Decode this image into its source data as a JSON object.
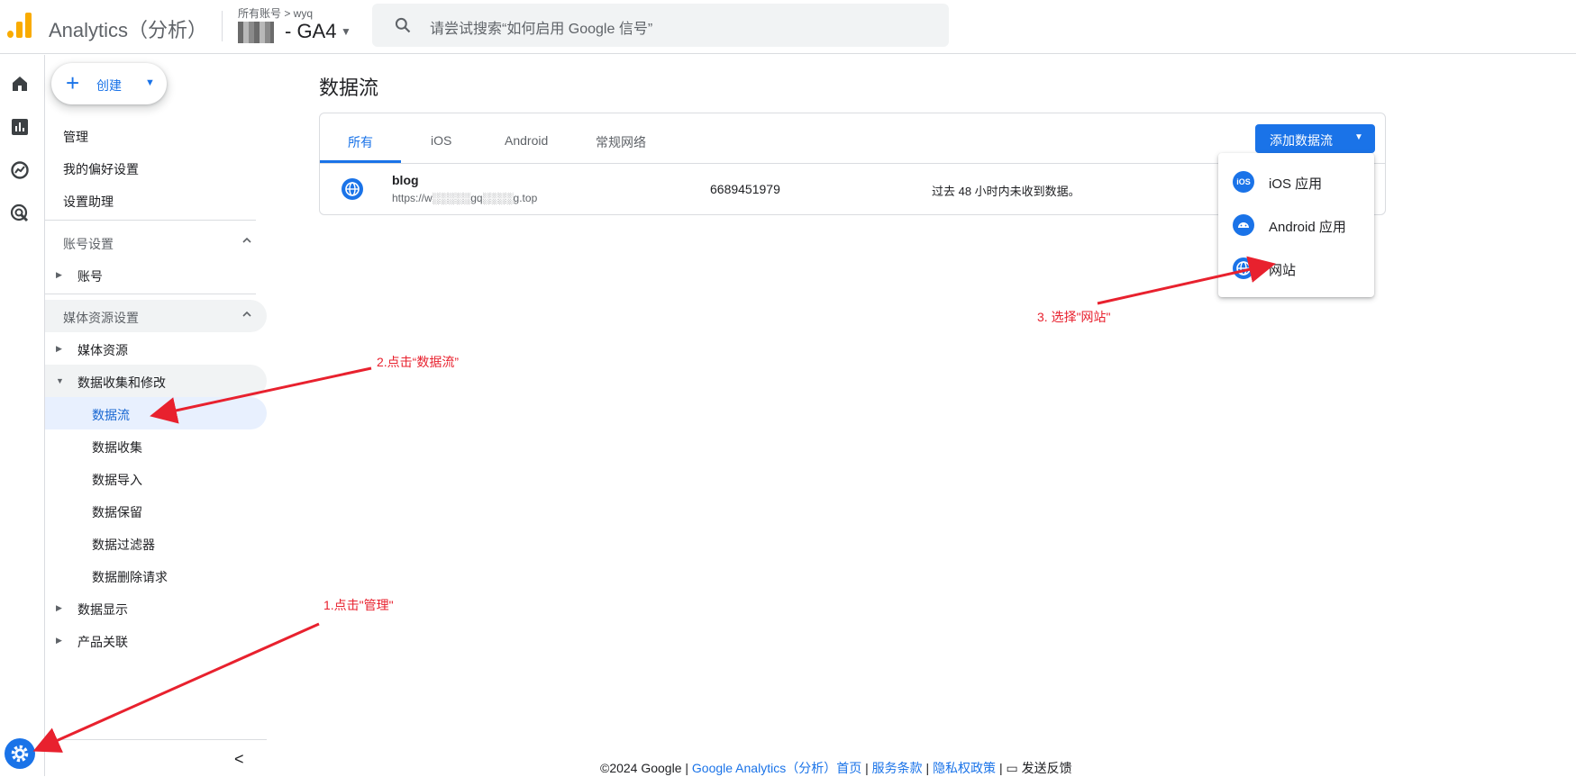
{
  "header": {
    "app_title": "Analytics（分析）",
    "breadcrumb": "所有账号 > wyq",
    "property_name": "- GA4",
    "search_placeholder": "请尝试搜索“如何启用 Google 信号”"
  },
  "sidenav": {
    "create_label": "创建",
    "top_items": [
      "管理",
      "我的偏好设置",
      "设置助理"
    ],
    "account_settings": {
      "title": "账号设置",
      "items": [
        "账号"
      ]
    },
    "property_settings": {
      "title": "媒体资源设置",
      "items": [
        "媒体资源",
        "数据收集和修改"
      ],
      "sub_items": [
        "数据流",
        "数据收集",
        "数据导入",
        "数据保留",
        "数据过滤器",
        "数据删除请求"
      ],
      "after_items": [
        "数据显示",
        "产品关联"
      ]
    }
  },
  "main": {
    "page_title": "数据流",
    "tabs": [
      "所有",
      "iOS",
      "Android",
      "常规网络"
    ],
    "add_stream_label": "添加数据流",
    "stream": {
      "name": "blog",
      "url": "https://w░░░░░gq░░░░g.top",
      "stream_id": "6689451979",
      "status": "过去 48 小时内未收到数据。"
    },
    "add_menu": [
      "iOS 应用",
      "Android 应用",
      "网站"
    ],
    "ios_icon_text": "iOS"
  },
  "annotations": {
    "step1": "1.点击\"管理\"",
    "step2": "2.点击“数据流”",
    "step3": "3. 选择\"网站\""
  },
  "footer": {
    "copyright": "©2024 Google | ",
    "link_ga": "Google Analytics（分析）首页",
    "sep1": " | ",
    "link_terms": "服务条款",
    "sep2": " | ",
    "link_privacy": "隐私权政策",
    "sep3": " | ",
    "feedback": "发送反馈"
  },
  "colors": {
    "accent": "#1a73e8",
    "annotation": "#e8212e",
    "logo": "#f9ab00"
  }
}
